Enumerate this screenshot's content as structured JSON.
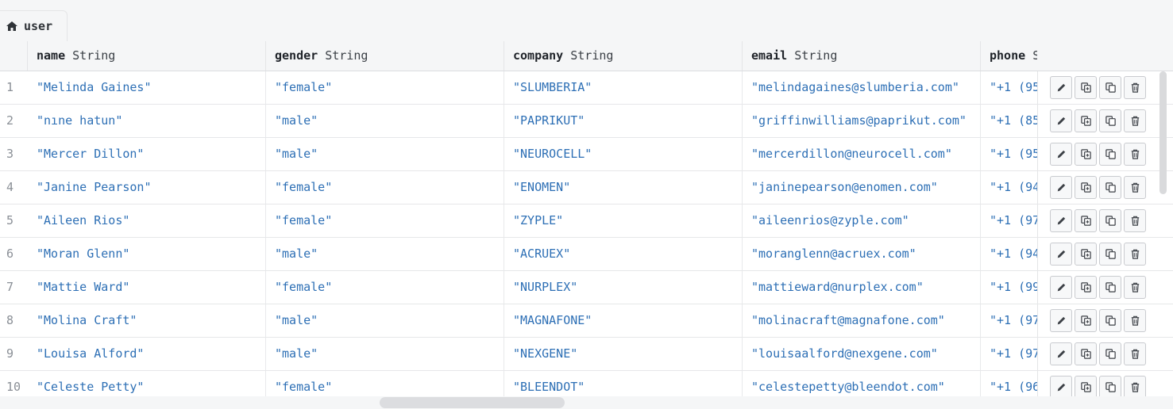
{
  "tab": {
    "label": "user",
    "icon": "home-icon"
  },
  "columns": [
    {
      "name": "name",
      "type": "String"
    },
    {
      "name": "gender",
      "type": "String"
    },
    {
      "name": "company",
      "type": "String"
    },
    {
      "name": "email",
      "type": "String"
    },
    {
      "name": "phone",
      "type": "S"
    }
  ],
  "rows": [
    {
      "num": "1",
      "name": "\"Melinda Gaines\"",
      "gender": "\"female\"",
      "company": "\"SLUMBERIA\"",
      "email": "\"melindagaines@slumberia.com\"",
      "phone": "\"+1 (95"
    },
    {
      "num": "2",
      "name": "\"nıne hatun\"",
      "gender": "\"male\"",
      "company": "\"PAPRIKUT\"",
      "email": "\"griffinwilliams@paprikut.com\"",
      "phone": "\"+1 (85"
    },
    {
      "num": "3",
      "name": "\"Mercer Dillon\"",
      "gender": "\"male\"",
      "company": "\"NEUROCELL\"",
      "email": "\"mercerdillon@neurocell.com\"",
      "phone": "\"+1 (95"
    },
    {
      "num": "4",
      "name": "\"Janine Pearson\"",
      "gender": "\"female\"",
      "company": "\"ENOMEN\"",
      "email": "\"janinepearson@enomen.com\"",
      "phone": "\"+1 (94"
    },
    {
      "num": "5",
      "name": "\"Aileen Rios\"",
      "gender": "\"female\"",
      "company": "\"ZYPLE\"",
      "email": "\"aileenrios@zyple.com\"",
      "phone": "\"+1 (97"
    },
    {
      "num": "6",
      "name": "\"Moran Glenn\"",
      "gender": "\"male\"",
      "company": "\"ACRUEX\"",
      "email": "\"moranglenn@acruex.com\"",
      "phone": "\"+1 (94"
    },
    {
      "num": "7",
      "name": "\"Mattie Ward\"",
      "gender": "\"female\"",
      "company": "\"NURPLEX\"",
      "email": "\"mattieward@nurplex.com\"",
      "phone": "\"+1 (99"
    },
    {
      "num": "8",
      "name": "\"Molina Craft\"",
      "gender": "\"male\"",
      "company": "\"MAGNAFONE\"",
      "email": "\"molinacraft@magnafone.com\"",
      "phone": "\"+1 (97"
    },
    {
      "num": "9",
      "name": "\"Louisa Alford\"",
      "gender": "\"male\"",
      "company": "\"NEXGENE\"",
      "email": "\"louisaalford@nexgene.com\"",
      "phone": "\"+1 (97"
    },
    {
      "num": "10",
      "name": "\"Celeste Petty\"",
      "gender": "\"female\"",
      "company": "\"BLEENDOT\"",
      "email": "\"celestepetty@bleendot.com\"",
      "phone": "\"+1 (96"
    }
  ],
  "row_actions": [
    "edit-icon",
    "clone-icon",
    "copy-icon",
    "delete-icon"
  ],
  "colors": {
    "value": "#2d6fb5",
    "header_bg": "#f5f6f7",
    "border": "#e4e5e7"
  }
}
